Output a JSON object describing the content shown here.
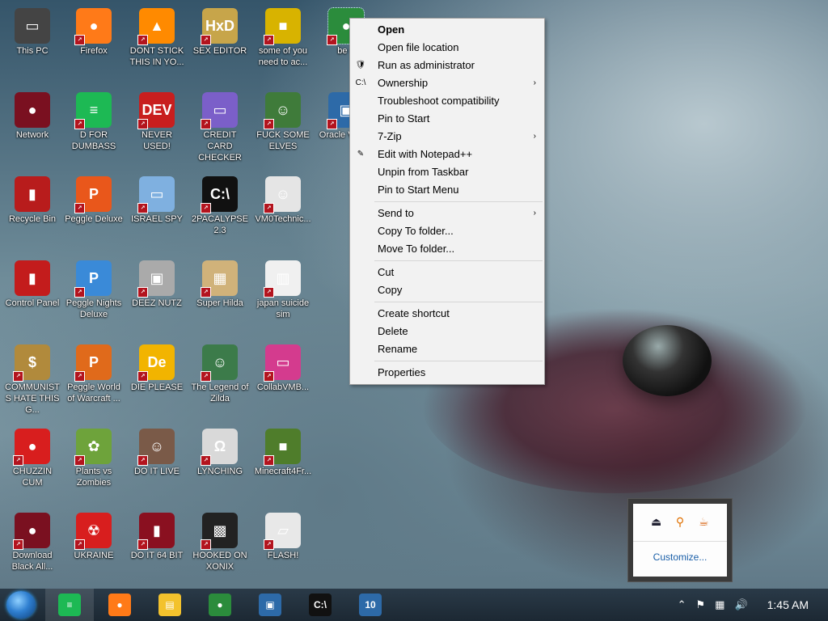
{
  "desktop": {
    "icons": [
      {
        "label": "This PC",
        "glyph": "▭",
        "color": "#444"
      },
      {
        "label": "Firefox",
        "glyph": "●",
        "color": "#ff7a18"
      },
      {
        "label": "DONT STICK THIS IN YO...",
        "glyph": "▲",
        "color": "#ff8a00"
      },
      {
        "label": "SEX EDITOR",
        "glyph": "HxD",
        "color": "#c7a54a"
      },
      {
        "label": "some of you need to ac...",
        "glyph": "■",
        "color": "#d8b300"
      },
      {
        "label": "be e",
        "glyph": "●",
        "color": "#2b8c3c"
      },
      {
        "label": "Network",
        "glyph": "●",
        "color": "#7a1020"
      },
      {
        "label": "D FOR DUMBASS",
        "glyph": "≡",
        "color": "#1db954"
      },
      {
        "label": "NEVER USED!",
        "glyph": "DEV",
        "color": "#c81e1e"
      },
      {
        "label": "CREDIT CARD CHECKER",
        "glyph": "▭",
        "color": "#7b5fc9"
      },
      {
        "label": "FUCK SOME ELVES",
        "glyph": "☺",
        "color": "#3f7b3a"
      },
      {
        "label": "Oracle Virtual",
        "glyph": "▣",
        "color": "#2d6aa8"
      },
      {
        "label": "Recycle Bin",
        "glyph": "▮",
        "color": "#b81c1c"
      },
      {
        "label": "Peggle Deluxe",
        "glyph": "P",
        "color": "#e9571b"
      },
      {
        "label": "ISRAEL SPY",
        "glyph": "▭",
        "color": "#7fb0e0"
      },
      {
        "label": "2PACALYPSE 2.3",
        "glyph": "C:\\",
        "color": "#111"
      },
      {
        "label": "VM0Technic...",
        "glyph": "☺",
        "color": "#e5e5e5"
      },
      {
        "label": "Control Panel",
        "glyph": "▮",
        "color": "#c31c1c"
      },
      {
        "label": "Peggle Nights Deluxe",
        "glyph": "P",
        "color": "#3a8ad8"
      },
      {
        "label": "DEEZ NUTZ",
        "glyph": "▣",
        "color": "#aaa"
      },
      {
        "label": "Super Hilda",
        "glyph": "▦",
        "color": "#d0b27a"
      },
      {
        "label": "japan suicide sim",
        "glyph": "▥",
        "color": "#f0f0f0"
      },
      {
        "label": "COMMUNISTS HATE THIS G...",
        "glyph": "$",
        "color": "#b18a3c"
      },
      {
        "label": "Peggle World of Warcraft ...",
        "glyph": "P",
        "color": "#e06a1b"
      },
      {
        "label": "DIE PLEASE",
        "glyph": "De",
        "color": "#f2b400"
      },
      {
        "label": "The Legend of Zilda",
        "glyph": "☺",
        "color": "#3c7b4a"
      },
      {
        "label": "CollabVMB...",
        "glyph": "▭",
        "color": "#d43b8e"
      },
      {
        "label": "CHUZZIN CUM",
        "glyph": "●",
        "color": "#d81e1e"
      },
      {
        "label": "Plants vs Zombies",
        "glyph": "✿",
        "color": "#6ea33b"
      },
      {
        "label": "DO IT LIVE",
        "glyph": "☺",
        "color": "#7a5a48"
      },
      {
        "label": "LYNCHING",
        "glyph": "Ω",
        "color": "#d9d9d9"
      },
      {
        "label": "Minecraft4Fr...",
        "glyph": "■",
        "color": "#4f7d2b"
      },
      {
        "label": "Download Black All...",
        "glyph": "●",
        "color": "#7a1020"
      },
      {
        "label": "UKRAINE",
        "glyph": "☢",
        "color": "#d81e1e"
      },
      {
        "label": "DO IT 64 BIT",
        "glyph": "▮",
        "color": "#8a1020"
      },
      {
        "label": "HOOKED ON XONIX",
        "glyph": "▩",
        "color": "#222"
      },
      {
        "label": "FLASH!",
        "glyph": "▱",
        "color": "#e8e8e8"
      }
    ]
  },
  "context_menu": {
    "items": [
      {
        "label": "Open",
        "bold": true
      },
      {
        "label": "Open file location"
      },
      {
        "label": "Run as administrator",
        "icon": "shield-icon"
      },
      {
        "label": "Ownership",
        "icon": "cmd-icon",
        "submenu": true
      },
      {
        "label": "Troubleshoot compatibility"
      },
      {
        "label": "Pin to Start"
      },
      {
        "label": "7-Zip",
        "submenu": true
      },
      {
        "label": "Edit with Notepad++",
        "icon": "notepadpp-icon"
      },
      {
        "label": "Unpin from Taskbar"
      },
      {
        "label": "Pin to Start Menu"
      },
      {
        "sep": true
      },
      {
        "label": "Send to",
        "submenu": true
      },
      {
        "label": "Copy To folder..."
      },
      {
        "label": "Move To folder..."
      },
      {
        "sep": true
      },
      {
        "label": "Cut"
      },
      {
        "label": "Copy"
      },
      {
        "sep": true
      },
      {
        "label": "Create shortcut"
      },
      {
        "label": "Delete"
      },
      {
        "label": "Rename"
      },
      {
        "sep": true
      },
      {
        "label": "Properties"
      }
    ]
  },
  "tray_popup": {
    "customize_label": "Customize...",
    "icons": [
      "usb-icon",
      "search-icon",
      "java-icon"
    ]
  },
  "taskbar": {
    "buttons": [
      {
        "name": "spotify",
        "glyph": "≡",
        "color": "#1db954",
        "active": true
      },
      {
        "name": "firefox",
        "glyph": "●",
        "color": "#ff7a18"
      },
      {
        "name": "file-explorer",
        "glyph": "▤",
        "color": "#f3c22d"
      },
      {
        "name": "chrome",
        "glyph": "●",
        "color": "#2b8c3c"
      },
      {
        "name": "virtualbox",
        "glyph": "▣",
        "color": "#2d6aa8"
      },
      {
        "name": "command-prompt",
        "glyph": "C:\\",
        "color": "#111"
      },
      {
        "name": "windows-10-app",
        "glyph": "10",
        "color": "#2d6aa8"
      }
    ],
    "tray": {
      "clock": "1:45 AM",
      "show_hidden": "⌃",
      "flag": "⚑",
      "network": "▦",
      "volume": "🔊"
    }
  }
}
